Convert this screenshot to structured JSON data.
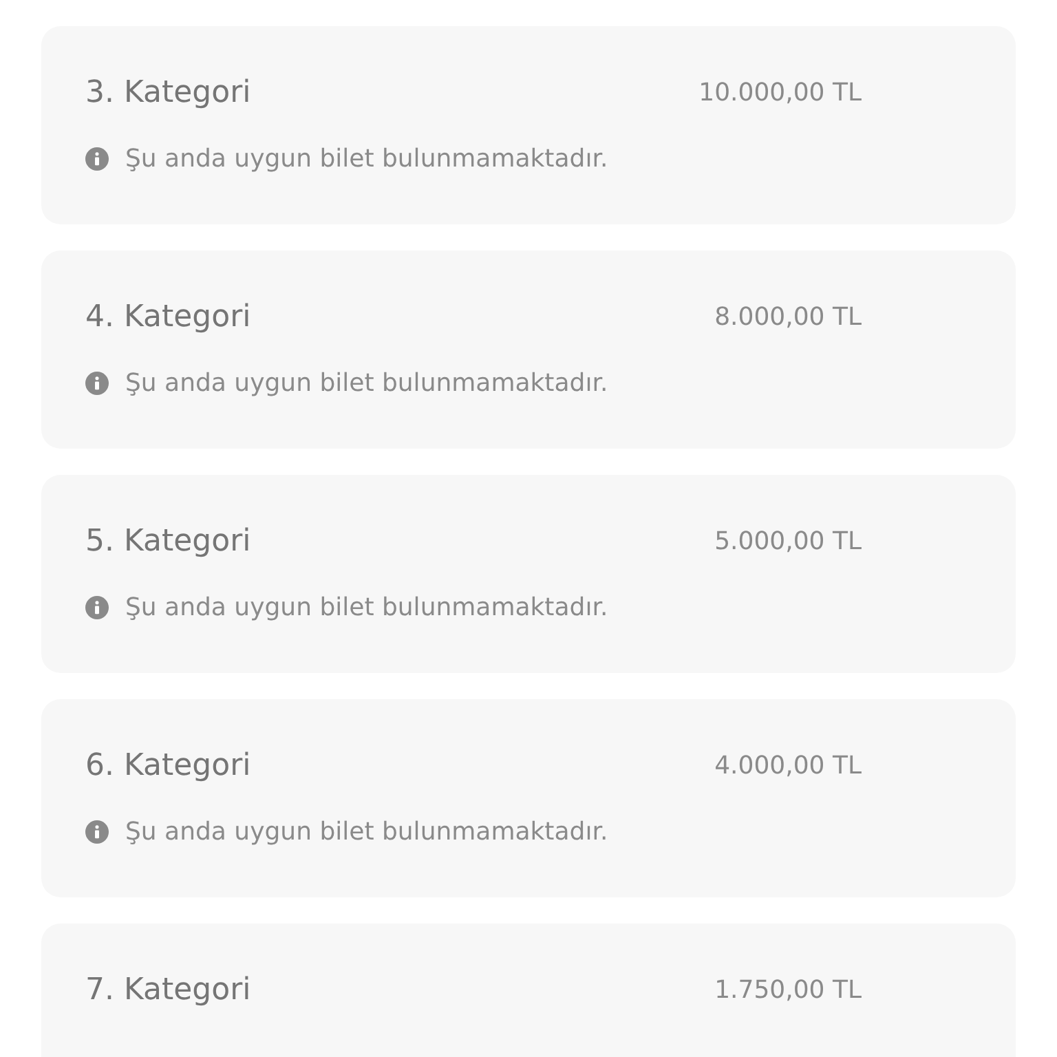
{
  "categories": [
    {
      "title": "3. Kategori",
      "price": "10.000,00 TL",
      "notice": "Şu anda uygun bilet bulunmamaktadır."
    },
    {
      "title": "4. Kategori",
      "price": "8.000,00 TL",
      "notice": "Şu anda uygun bilet bulunmamaktadır."
    },
    {
      "title": "5. Kategori",
      "price": "5.000,00 TL",
      "notice": "Şu anda uygun bilet bulunmamaktadır."
    },
    {
      "title": "6. Kategori",
      "price": "4.000,00 TL",
      "notice": "Şu anda uygun bilet bulunmamaktadır."
    },
    {
      "title": "7. Kategori",
      "price": "1.750,00 TL"
    }
  ]
}
